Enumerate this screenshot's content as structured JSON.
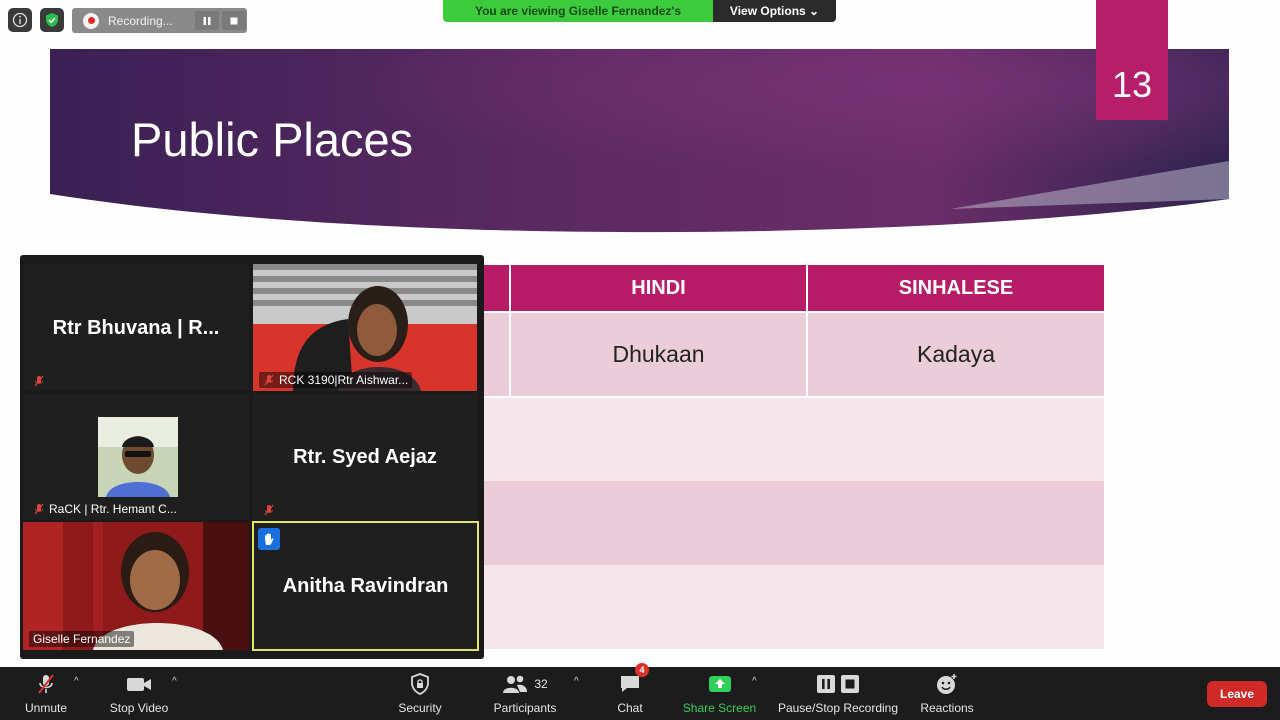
{
  "recording": {
    "label": "Recording..."
  },
  "banner": {
    "viewing_text": "You are viewing Giselle Fernandez's screen",
    "view_options": "View Options ⌄"
  },
  "slide": {
    "number": "13",
    "title": "Public Places",
    "table": {
      "headers": [
        "HINDI",
        "SINHALESE"
      ],
      "rows": [
        [
          "Dhukaan",
          "Kadaya"
        ],
        [
          "",
          ""
        ],
        [
          "",
          ""
        ],
        [
          "",
          ""
        ]
      ]
    }
  },
  "gallery": {
    "tiles": [
      {
        "name": "Rtr Bhuvana | R...",
        "label": ""
      },
      {
        "name": "",
        "label": "RCK 3190|Rtr Aishwar..."
      },
      {
        "name": "",
        "label": "RaCK | Rtr. Hemant C..."
      },
      {
        "name": "Rtr. Syed Aejaz",
        "label": ""
      },
      {
        "name": "",
        "label": "Giselle Fernandez"
      },
      {
        "name": "Anitha Ravindran",
        "label": ""
      }
    ]
  },
  "toolbar": {
    "unmute": "Unmute",
    "stop_video": "Stop Video",
    "security": "Security",
    "participants": "Participants",
    "participants_count": "32",
    "chat": "Chat",
    "chat_badge": "4",
    "share_screen": "Share Screen",
    "pause_recording": "Pause/Stop Recording",
    "reactions": "Reactions",
    "leave": "Leave"
  },
  "colors": {
    "slide_accent": "#b71c66",
    "share_green": "#2fd05a",
    "leave_red": "#d02a28",
    "banner_green": "#3ccb3c"
  }
}
